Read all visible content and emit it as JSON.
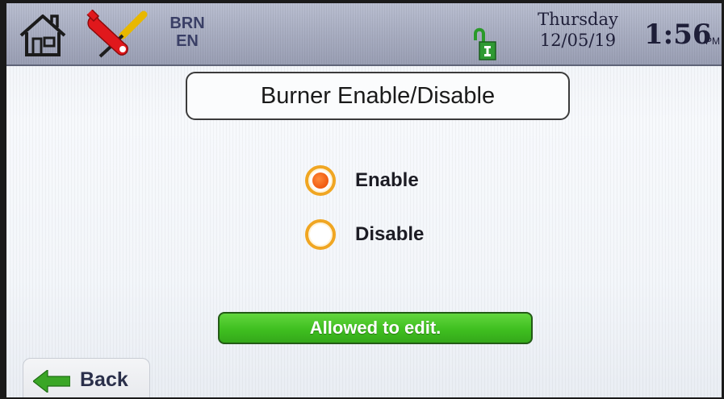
{
  "header": {
    "mode_line1": "BRN",
    "mode_line2": "EN",
    "day": "Thursday",
    "date": "12/05/19",
    "time": "1:56",
    "ampm": "PM",
    "icons": [
      "home-icon",
      "tools-icon",
      "unlocked-padlock-icon"
    ]
  },
  "title": "Burner Enable/Disable",
  "options": [
    {
      "label": "Enable",
      "selected": true
    },
    {
      "label": "Disable",
      "selected": false
    }
  ],
  "status": {
    "text": "Allowed to edit.",
    "color": "#3fbf20"
  },
  "footer": {
    "back_label": "Back"
  },
  "colors": {
    "accent_orange": "#f0a622",
    "selected_dot": "#f05a10",
    "arrow_green": "#3aa626"
  }
}
